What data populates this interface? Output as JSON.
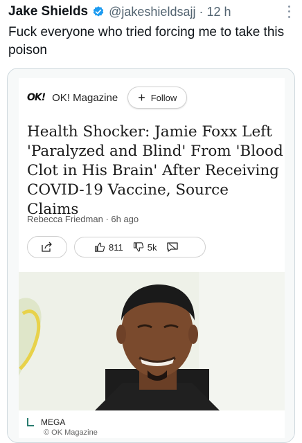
{
  "tweet": {
    "author_name": "Jake Shields",
    "handle": "@jakeshieldsajj",
    "separator": "·",
    "time": "12 h",
    "text": "Fuck everyone who tried forcing me to take this poison"
  },
  "card": {
    "source_logo": "OK!",
    "source_name": "OK! Magazine",
    "follow_label": "Follow",
    "follow_icon": "+",
    "headline": "Health Shocker: Jamie Foxx Left 'Paralyzed and Blind' From 'Blood Clot in His Brain' After Receiving COVID-19 Vaccine, Source Claims",
    "byline": "Rebecca Friedman · 6h ago",
    "likes": "811",
    "dislikes": "5k",
    "icons": [
      "share-icon",
      "thumbs-up-icon",
      "thumbs-down-icon",
      "comment-icon"
    ],
    "image_credit": "MEGA",
    "copyright": "© OK Magazine"
  },
  "colors": {
    "verified": "#1d9bf0",
    "muted_text": "#536471",
    "card_border": "#cfd9de",
    "credit_accent": "#2a7c6f"
  }
}
